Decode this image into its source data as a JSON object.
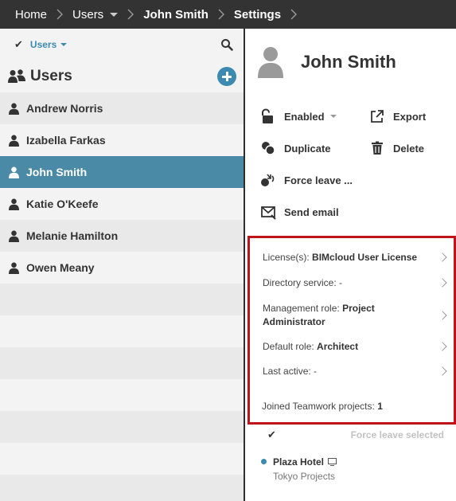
{
  "breadcrumb": {
    "home": "Home",
    "users": "Users",
    "user": "John Smith",
    "settings": "Settings"
  },
  "filter": {
    "label": "Users"
  },
  "users_panel": {
    "title": "Users",
    "items": [
      {
        "name": "Andrew Norris"
      },
      {
        "name": "Izabella Farkas"
      },
      {
        "name": "John Smith"
      },
      {
        "name": "Katie O'Keefe"
      },
      {
        "name": "Melanie Hamilton"
      },
      {
        "name": "Owen Meany"
      }
    ],
    "selected_index": 2
  },
  "profile": {
    "name": "John Smith"
  },
  "actions": {
    "enabled": "Enabled",
    "export": "Export",
    "duplicate": "Duplicate",
    "delete": "Delete",
    "force_leave": "Force leave ...",
    "send_email": "Send email"
  },
  "details": {
    "license_label": "License(s):",
    "license_value": "BIMcloud User License",
    "directory_label": "Directory service:",
    "directory_value": "-",
    "mgmt_role_label": "Management role:",
    "mgmt_role_value_1": "Project",
    "mgmt_role_value_2": "Administrator",
    "default_role_label": "Default role:",
    "default_role_value": "Architect",
    "last_active_label": "Last active:",
    "last_active_value": "-",
    "joined_label": "Joined Teamwork projects:",
    "joined_value": "1"
  },
  "projects": {
    "force_leave_selected": "Force leave selected",
    "items": [
      {
        "name": "Plaza Hotel",
        "folder": "Tokyo Projects"
      }
    ]
  },
  "colors": {
    "accent": "#3c8ab0",
    "selected_row": "#4a8aa7",
    "highlight_border": "#c0141b",
    "topbar": "#333333"
  }
}
